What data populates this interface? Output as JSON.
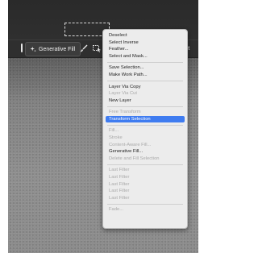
{
  "taskbar": {
    "generative_fill_label": "Generative Fill",
    "deselect_label": "Deselect"
  },
  "icons": {
    "generative_fill": "sparkle-icon",
    "brush": "brush-icon",
    "selection": "selection-icon"
  },
  "colors": {
    "menu_highlight": "#3f7cf0",
    "menu_bg": "#ececec",
    "disabled_text": "#a9a9a9"
  },
  "menu": {
    "sections": [
      [
        {
          "label": "Deselect",
          "enabled": true,
          "highlighted": false
        },
        {
          "label": "Select Inverse",
          "enabled": true,
          "highlighted": false
        },
        {
          "label": "Feather...",
          "enabled": true,
          "highlighted": false
        },
        {
          "label": "Select and Mask...",
          "enabled": true,
          "highlighted": false
        }
      ],
      [
        {
          "label": "Save Selection...",
          "enabled": true,
          "highlighted": false
        },
        {
          "label": "Make Work Path...",
          "enabled": true,
          "highlighted": false
        }
      ],
      [
        {
          "label": "Layer Via Copy",
          "enabled": true,
          "highlighted": false
        },
        {
          "label": "Layer Via Cut",
          "enabled": false,
          "highlighted": false
        },
        {
          "label": "New Layer",
          "enabled": true,
          "highlighted": false
        }
      ],
      [
        {
          "label": "Free Transform",
          "enabled": false,
          "highlighted": false
        },
        {
          "label": "Transform Selection",
          "enabled": true,
          "highlighted": true
        }
      ],
      [
        {
          "label": "Fill...",
          "enabled": false,
          "highlighted": false
        },
        {
          "label": "Stroke",
          "enabled": false,
          "highlighted": false
        },
        {
          "label": "Content-Aware Fill...",
          "enabled": false,
          "highlighted": false
        },
        {
          "label": "Generative Fill...",
          "enabled": true,
          "highlighted": false
        },
        {
          "label": "Delete and Fill Selection",
          "enabled": false,
          "highlighted": false
        }
      ],
      [
        {
          "label": "Last Filter",
          "enabled": false,
          "highlighted": false
        },
        {
          "label": "Last Filter",
          "enabled": false,
          "highlighted": false
        },
        {
          "label": "Last Filter",
          "enabled": false,
          "highlighted": false
        },
        {
          "label": "Last Filter",
          "enabled": false,
          "highlighted": false
        },
        {
          "label": "Last Filter",
          "enabled": false,
          "highlighted": false
        }
      ],
      [
        {
          "label": "Fade...",
          "enabled": false,
          "highlighted": false
        }
      ]
    ]
  }
}
